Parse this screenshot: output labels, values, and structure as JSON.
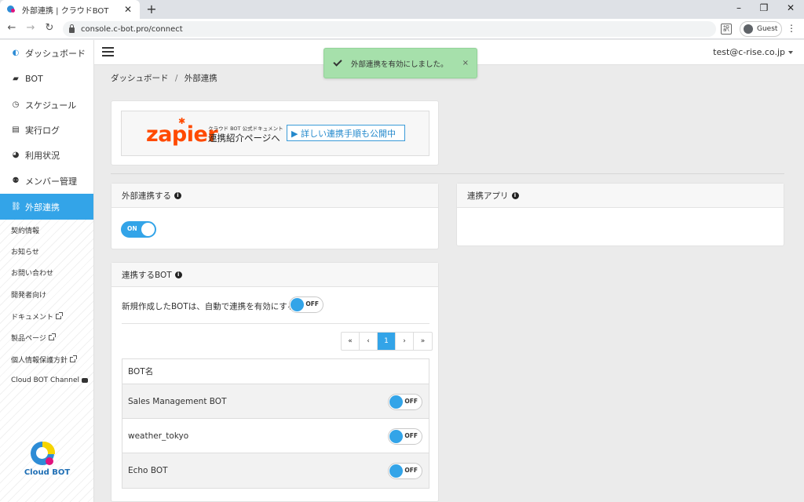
{
  "browser": {
    "tab_title": "外部連携 | クラウドBOT",
    "tab_close": "✕",
    "new_tab": "+",
    "url": "console.c-bot.pro/connect",
    "guest_label": "Guest",
    "minimize": "–",
    "restore": "❐",
    "close": "✕",
    "back": "←",
    "forward": "→",
    "reload": "↻",
    "translate": "訳",
    "menu": "⋮"
  },
  "sidebar": {
    "items": [
      {
        "label": "ダッシュボード",
        "icon": "cloud-bot-icon",
        "glyph": "◐"
      },
      {
        "label": "BOT",
        "icon": "robot-icon",
        "glyph": "▰"
      },
      {
        "label": "スケジュール",
        "icon": "clock-icon",
        "glyph": "◷"
      },
      {
        "label": "実行ログ",
        "icon": "file-icon",
        "glyph": "▤"
      },
      {
        "label": "利用状況",
        "icon": "pie-chart-icon",
        "glyph": "◕"
      },
      {
        "label": "メンバー管理",
        "icon": "users-icon",
        "glyph": "⚉"
      },
      {
        "label": "外部連携",
        "icon": "link-icon",
        "glyph": "⛓"
      }
    ],
    "sub_items": [
      {
        "label": "契約情報"
      },
      {
        "label": "お知らせ"
      },
      {
        "label": "お問い合わせ"
      },
      {
        "label": "開発者向け"
      },
      {
        "label": "ドキュメント"
      },
      {
        "label": "製品ページ"
      },
      {
        "label": "個人情報保護方針"
      },
      {
        "label": "Cloud BOT Channel"
      }
    ],
    "logo_text": "Cloud BOT"
  },
  "header": {
    "user_email": "test@c-rise.co.jp"
  },
  "toast": {
    "message": "外部連携を有効にしました。",
    "close": "×"
  },
  "breadcrumb": {
    "home": "ダッシュボード",
    "separator": "/",
    "current": "外部連携"
  },
  "banner": {
    "brand": "zapier",
    "small_text": "クラウド BOT 公式ドキュメント",
    "big_text": "連携紹介ページへ",
    "button": "▶ 詳しい連携手順も公開中"
  },
  "external_link": {
    "title": "外部連携する",
    "info": "i",
    "toggle": "ON"
  },
  "linked_apps": {
    "title": "連携アプリ",
    "info": "i"
  },
  "linked_bots": {
    "title": "連携するBOT",
    "info": "i",
    "auto_label": "新規作成したBOTは、自動で連携を有効にする",
    "auto_toggle": "OFF",
    "pager": [
      "«",
      "‹",
      "1",
      "›",
      "»"
    ],
    "column_header": "BOT名",
    "rows": [
      {
        "name": "Sales Management BOT",
        "toggle": "OFF"
      },
      {
        "name": "weather_tokyo",
        "toggle": "OFF"
      },
      {
        "name": "Echo BOT",
        "toggle": "OFF"
      }
    ]
  },
  "colors": {
    "accent": "#33a4e8",
    "toast_bg": "#a6e0ab",
    "zapier": "#ff4a00"
  }
}
